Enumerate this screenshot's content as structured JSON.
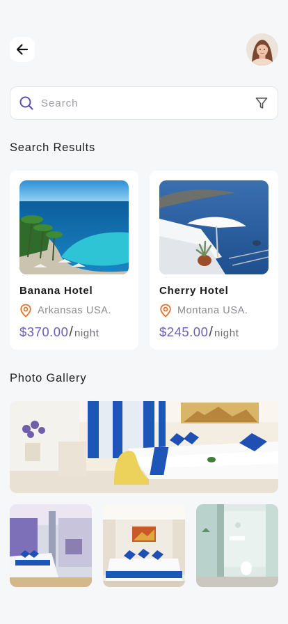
{
  "header": {
    "back_icon": "arrow-left-icon",
    "avatar": "user-avatar"
  },
  "search": {
    "placeholder": "Search",
    "value": "",
    "icon": "search-icon",
    "filter_icon": "filter-icon"
  },
  "results": {
    "title": "Search Results",
    "hotels": [
      {
        "name": "Banana Hotel",
        "location": "Arkansas USA.",
        "price": "$370.00",
        "slash": "/",
        "unit": "night"
      },
      {
        "name": "Cherry Hotel",
        "location": "Montana USA.",
        "price": "$245.00",
        "slash": "/",
        "unit": "night"
      }
    ]
  },
  "gallery": {
    "title": "Photo Gallery"
  },
  "colors": {
    "accent": "#6c5dbc",
    "pin": "#e4702a",
    "background": "#f6f7f9",
    "card": "#ffffff"
  }
}
